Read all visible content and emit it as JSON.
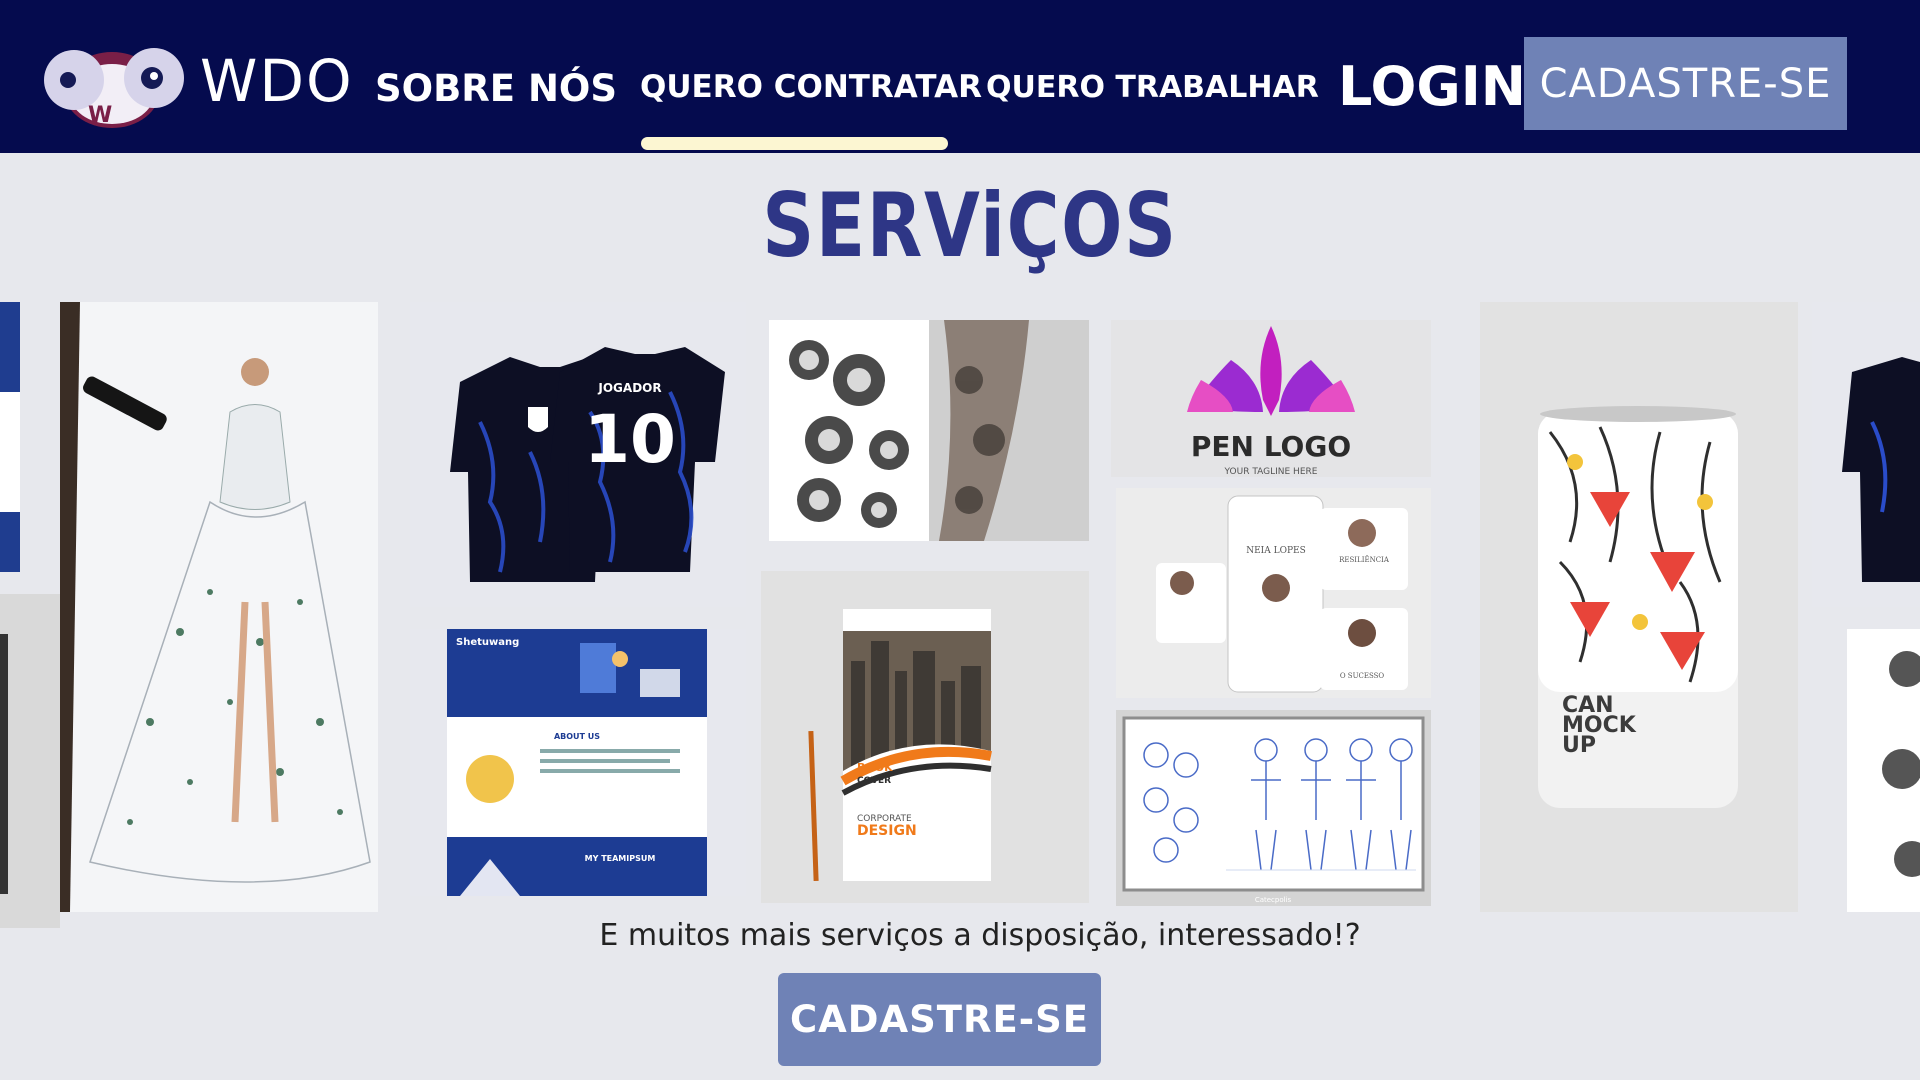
{
  "brand": {
    "name": "WDO",
    "logo_letters": [
      "D",
      "W",
      "O"
    ]
  },
  "nav": {
    "items": [
      {
        "label": "SOBRE NÓS"
      },
      {
        "label": "QUERO CONTRATAR"
      },
      {
        "label": "QUERO TRABALHAR"
      }
    ],
    "active_index": 1,
    "login_label": "LOGIN",
    "signup_label": "CADASTRE-SE"
  },
  "services": {
    "title": "SERViÇOS",
    "gallery": {
      "jersey": {
        "text": "JOGADOR",
        "number": "10"
      },
      "website": {
        "brand": "Shetuwang",
        "about": "ABOUT US",
        "team": "MY TEAMIPSUM"
      },
      "book": {
        "title1": "BOOK",
        "title2": "COVER",
        "subtitle1": "CORPORATE",
        "subtitle2": "DESIGN"
      },
      "pen_logo": {
        "text": "PEN LOGO",
        "tagline": "YOUR TAGLINE HERE"
      },
      "social": {
        "name": "NEIA LOPES",
        "word1": "RESILIÊNCIA",
        "word2": "O SUCESSO"
      },
      "can": {
        "line1": "CAN",
        "line2": "MOCK",
        "line3": "UP"
      },
      "sketch": {
        "brand": "Catecpolis"
      }
    },
    "cta_text": "E muitos mais serviços a disposição, interessado!?",
    "cta_button": "CADASTRE-SE"
  },
  "colors": {
    "nav_bg": "#050b4e",
    "page_bg": "#e7e8ed",
    "accent": "#6f82b6",
    "title": "#2e3686",
    "underline": "#fcf6d2"
  }
}
